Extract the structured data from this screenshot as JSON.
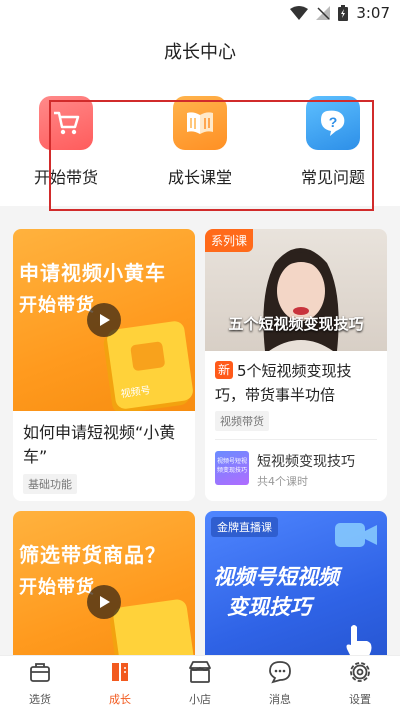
{
  "status": {
    "time": "3:07"
  },
  "header": {
    "title": "成长中心"
  },
  "quick_actions": [
    {
      "label": "开始带货",
      "icon": "shopping-cart-icon",
      "color": "#ff6b6b"
    },
    {
      "label": "成长课堂",
      "icon": "open-book-icon",
      "color": "#ff9f2e"
    },
    {
      "label": "常见问题",
      "icon": "question-bubble-icon",
      "color": "#3aa3f0"
    }
  ],
  "cards": [
    {
      "thumb_title": "申请视频小黄车",
      "thumb_subtitle": "开始带货",
      "thumb_logo_text": "视频号",
      "title": "如何申请短视频“小黄车”",
      "tag": "基础功能"
    },
    {
      "badge": "系列课",
      "thumb_caption": "五个短视频变现技巧",
      "new_badge": "新",
      "title": "5个短视频变现技巧，带货事半功倍",
      "tag": "视频带货",
      "sub_title": "短视频变现技巧",
      "sub_meta": "共4个课时",
      "sub_thumb_text": "视频号短视频变现技巧"
    },
    {
      "thumb_title": "筛选带货商品？",
      "thumb_subtitle": "开始带货"
    },
    {
      "badge": "金牌直播课",
      "thumb_title_line1": "视频号短视频",
      "thumb_title_line2": "变现技巧"
    }
  ],
  "tabs": [
    {
      "label": "选货",
      "icon": "bag-icon",
      "active": false
    },
    {
      "label": "成长",
      "icon": "book-icon",
      "active": true
    },
    {
      "label": "小店",
      "icon": "shop-icon",
      "active": false
    },
    {
      "label": "消息",
      "icon": "chat-icon",
      "active": false
    },
    {
      "label": "设置",
      "icon": "gear-icon",
      "active": false
    }
  ],
  "colors": {
    "accent": "#f25a1f",
    "annotation": "#d12b2b"
  }
}
